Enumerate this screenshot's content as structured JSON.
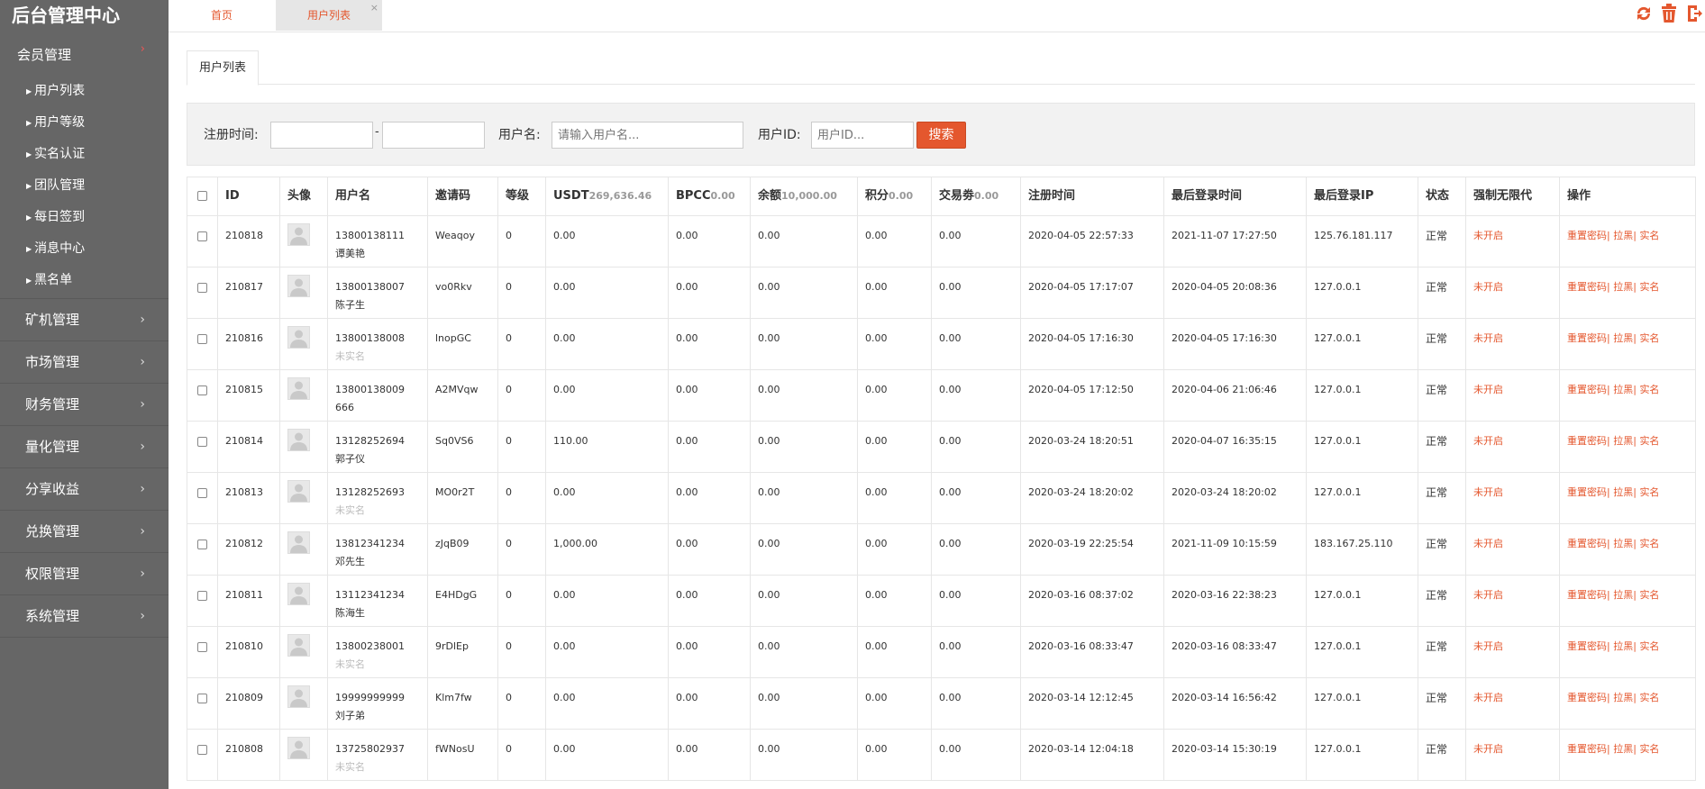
{
  "brand": "后台管理中心",
  "sidebar": {
    "member": {
      "label": "会员管理",
      "items": [
        "用户列表",
        "用户等级",
        "实名认证",
        "团队管理",
        "每日签到",
        "消息中心",
        "黑名单"
      ]
    },
    "groups": [
      "矿机管理",
      "市场管理",
      "财务管理",
      "量化管理",
      "分享收益",
      "兑换管理",
      "权限管理",
      "系统管理"
    ]
  },
  "tabs": {
    "home": "首页",
    "users": "用户列表",
    "close": "×"
  },
  "page_tab": "用户列表",
  "filter": {
    "reg_time_label": "注册时间:",
    "dash": "-",
    "username_label": "用户名:",
    "username_placeholder": "请输入用户名...",
    "userid_label": "用户ID:",
    "userid_placeholder": "用户ID...",
    "search": "搜索"
  },
  "table": {
    "headers": {
      "id": "ID",
      "avatar": "头像",
      "username": "用户名",
      "invite": "邀请码",
      "level": "等级",
      "usdt": "USDT",
      "usdt_total": "269,636.46",
      "bpcc": "BPCC",
      "bpcc_total": "0.00",
      "balance": "余额",
      "balance_total": "10,000.00",
      "points": "积分",
      "points_total": "0.00",
      "coupon": "交易劵",
      "coupon_total": "0.00",
      "reg_time": "注册时间",
      "last_login": "最后登录时间",
      "last_ip": "最后登录IP",
      "status": "状态",
      "unlimited": "强制无限代",
      "ops": "操作"
    },
    "ops": {
      "reset": "重置密码",
      "sep": "|",
      "block": "拉黑",
      "realname": "实名"
    },
    "rows": [
      {
        "id": "210818",
        "phone": "13800138111",
        "name": "谭美艳",
        "real": true,
        "invite": "Weaqoy",
        "level": "0",
        "usdt": "0.00",
        "bpcc": "0.00",
        "balance": "0.00",
        "points": "0.00",
        "coupon": "0.00",
        "reg": "2020-04-05 22:57:33",
        "login": "2021-11-07 17:27:50",
        "ip": "125.76.181.117",
        "status": "正常",
        "unlimited": "未开启"
      },
      {
        "id": "210817",
        "phone": "13800138007",
        "name": "陈子生",
        "real": true,
        "invite": "vo0Rkv",
        "level": "0",
        "usdt": "0.00",
        "bpcc": "0.00",
        "balance": "0.00",
        "points": "0.00",
        "coupon": "0.00",
        "reg": "2020-04-05 17:17:07",
        "login": "2020-04-05 20:08:36",
        "ip": "127.0.0.1",
        "status": "正常",
        "unlimited": "未开启"
      },
      {
        "id": "210816",
        "phone": "13800138008",
        "name": "未实名",
        "real": false,
        "invite": "lnopGC",
        "level": "0",
        "usdt": "0.00",
        "bpcc": "0.00",
        "balance": "0.00",
        "points": "0.00",
        "coupon": "0.00",
        "reg": "2020-04-05 17:16:30",
        "login": "2020-04-05 17:16:30",
        "ip": "127.0.0.1",
        "status": "正常",
        "unlimited": "未开启"
      },
      {
        "id": "210815",
        "phone": "13800138009",
        "name": "666",
        "real": true,
        "invite": "A2MVqw",
        "level": "0",
        "usdt": "0.00",
        "bpcc": "0.00",
        "balance": "0.00",
        "points": "0.00",
        "coupon": "0.00",
        "reg": "2020-04-05 17:12:50",
        "login": "2020-04-06 21:06:46",
        "ip": "127.0.0.1",
        "status": "正常",
        "unlimited": "未开启"
      },
      {
        "id": "210814",
        "phone": "13128252694",
        "name": "郭子仪",
        "real": true,
        "invite": "Sq0VS6",
        "level": "0",
        "usdt": "110.00",
        "bpcc": "0.00",
        "balance": "0.00",
        "points": "0.00",
        "coupon": "0.00",
        "reg": "2020-03-24 18:20:51",
        "login": "2020-04-07 16:35:15",
        "ip": "127.0.0.1",
        "status": "正常",
        "unlimited": "未开启"
      },
      {
        "id": "210813",
        "phone": "13128252693",
        "name": "未实名",
        "real": false,
        "invite": "MO0r2T",
        "level": "0",
        "usdt": "0.00",
        "bpcc": "0.00",
        "balance": "0.00",
        "points": "0.00",
        "coupon": "0.00",
        "reg": "2020-03-24 18:20:02",
        "login": "2020-03-24 18:20:02",
        "ip": "127.0.0.1",
        "status": "正常",
        "unlimited": "未开启"
      },
      {
        "id": "210812",
        "phone": "13812341234",
        "name": "邓先生",
        "real": true,
        "invite": "zJqB09",
        "level": "0",
        "usdt": "1,000.00",
        "bpcc": "0.00",
        "balance": "0.00",
        "points": "0.00",
        "coupon": "0.00",
        "reg": "2020-03-19 22:25:54",
        "login": "2021-11-09 10:15:59",
        "ip": "183.167.25.110",
        "status": "正常",
        "unlimited": "未开启"
      },
      {
        "id": "210811",
        "phone": "13112341234",
        "name": "陈海生",
        "real": true,
        "invite": "E4HDgG",
        "level": "0",
        "usdt": "0.00",
        "bpcc": "0.00",
        "balance": "0.00",
        "points": "0.00",
        "coupon": "0.00",
        "reg": "2020-03-16 08:37:02",
        "login": "2020-03-16 22:38:23",
        "ip": "127.0.0.1",
        "status": "正常",
        "unlimited": "未开启"
      },
      {
        "id": "210810",
        "phone": "13800238001",
        "name": "未实名",
        "real": false,
        "invite": "9rDlEp",
        "level": "0",
        "usdt": "0.00",
        "bpcc": "0.00",
        "balance": "0.00",
        "points": "0.00",
        "coupon": "0.00",
        "reg": "2020-03-16 08:33:47",
        "login": "2020-03-16 08:33:47",
        "ip": "127.0.0.1",
        "status": "正常",
        "unlimited": "未开启"
      },
      {
        "id": "210809",
        "phone": "19999999999",
        "name": "刘子弟",
        "real": true,
        "invite": "Klm7fw",
        "level": "0",
        "usdt": "0.00",
        "bpcc": "0.00",
        "balance": "0.00",
        "points": "0.00",
        "coupon": "0.00",
        "reg": "2020-03-14 12:12:45",
        "login": "2020-03-14 16:56:42",
        "ip": "127.0.0.1",
        "status": "正常",
        "unlimited": "未开启"
      },
      {
        "id": "210808",
        "phone": "13725802937",
        "name": "未实名",
        "real": false,
        "invite": "fWNosU",
        "level": "0",
        "usdt": "0.00",
        "bpcc": "0.00",
        "balance": "0.00",
        "points": "0.00",
        "coupon": "0.00",
        "reg": "2020-03-14 12:04:18",
        "login": "2020-03-14 15:30:19",
        "ip": "127.0.0.1",
        "status": "正常",
        "unlimited": "未开启"
      }
    ]
  },
  "colors": {
    "accent": "#e4572e",
    "sidebar_bg": "#666666",
    "active_tab_bg": "#e6e6e6"
  },
  "icons": [
    "refresh-icon",
    "trash-icon",
    "logout-icon"
  ]
}
